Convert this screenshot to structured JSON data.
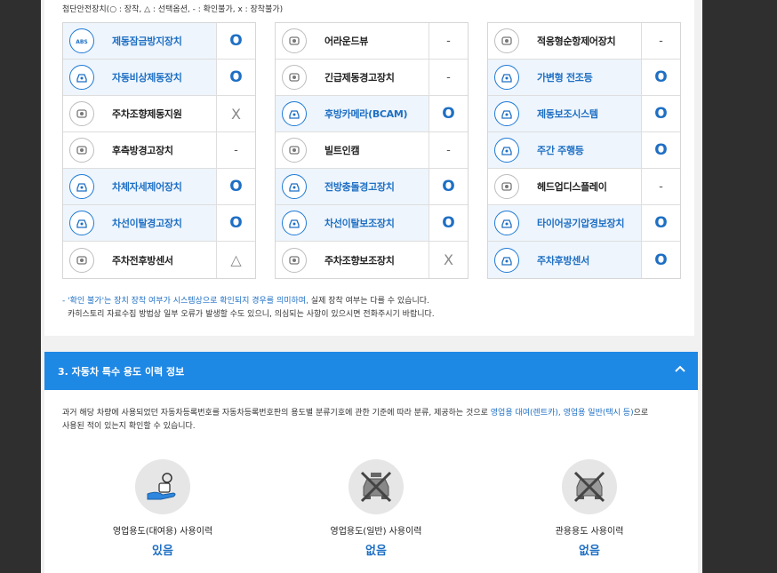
{
  "legend": "첨단안전장치(○ : 장착, △ : 선택옵션, - : 확인불가, x : 장착불가)",
  "tables": [
    [
      {
        "icon": "abs-icon",
        "label": "제동잠금방지장치",
        "status": "O",
        "equipped": true
      },
      {
        "icon": "emergency-brake-icon",
        "label": "자동비상제동장치",
        "status": "O",
        "equipped": true
      },
      {
        "icon": "parking-brake-icon",
        "label": "주차조향제동지원",
        "status": "X",
        "equipped": false
      },
      {
        "icon": "rear-side-warning-icon",
        "label": "후측방경고장치",
        "status": "-",
        "equipped": false
      },
      {
        "icon": "stability-control-icon",
        "label": "차체자세제어장치",
        "status": "O",
        "equipped": true
      },
      {
        "icon": "lane-departure-warning-icon",
        "label": "차선이탈경고장치",
        "status": "O",
        "equipped": true
      },
      {
        "icon": "parking-sensor-icon",
        "label": "주차전후방센서",
        "status": "△",
        "equipped": false
      }
    ],
    [
      {
        "icon": "around-view-icon",
        "label": "어라운드뷰",
        "status": "-",
        "equipped": false
      },
      {
        "icon": "emergency-brake-warning-icon",
        "label": "긴급제동경고장치",
        "status": "-",
        "equipped": false
      },
      {
        "icon": "rear-camera-icon",
        "label": "후방카메라(BCAM)",
        "status": "O",
        "equipped": true
      },
      {
        "icon": "builtin-cam-icon",
        "label": "빌트인캠",
        "status": "-",
        "equipped": false
      },
      {
        "icon": "forward-collision-icon",
        "label": "전방충돌경고장치",
        "status": "O",
        "equipped": true
      },
      {
        "icon": "lane-keeping-icon",
        "label": "차선이탈보조장치",
        "status": "O",
        "equipped": true
      },
      {
        "icon": "parking-assist-icon",
        "label": "주차조향보조장치",
        "status": "X",
        "equipped": false
      }
    ],
    [
      {
        "icon": "adaptive-cruise-icon",
        "label": "적응형순항제어장치",
        "status": "-",
        "equipped": false
      },
      {
        "icon": "adaptive-headlight-icon",
        "label": "가변형 전조등",
        "status": "O",
        "equipped": true
      },
      {
        "icon": "brake-assist-icon",
        "label": "제동보조시스템",
        "status": "O",
        "equipped": true
      },
      {
        "icon": "daytime-running-light-icon",
        "label": "주간 주행등",
        "status": "O",
        "equipped": true
      },
      {
        "icon": "head-up-display-icon",
        "label": "헤드업디스플레이",
        "status": "-",
        "equipped": false
      },
      {
        "icon": "tire-pressure-icon",
        "label": "타이어공기압경보장치",
        "status": "O",
        "equipped": true
      },
      {
        "icon": "rear-parking-sensor-icon",
        "label": "주차후방센서",
        "status": "O",
        "equipped": true
      }
    ]
  ],
  "note1_hl": "- '확인 불가'는 장치 장착 여부가 시스템상으로 확인되지 경우를 의미하며,",
  "note1_rest": " 실제 장착 여부는 다를 수 있습니다.",
  "note2": "카히스토리 자료수집 방법상 일부 오류가 발생할 수도 있으니, 의심되는 사항이 있으시면 전화주시기 바랍니다.",
  "section3": {
    "title": "3. 자동차 특수 용도 이력 정보",
    "desc_a": "과거 해당 차량에 사용되었던 자동차등록번호를 자동차등록번호판의 용도별 분류기호에 관한 기준에 따라 분류, 제공하는 것으로 ",
    "desc_hl": "영업용 대여(렌트카), 영업용 일반(택시 등)",
    "desc_b": "으로",
    "desc_c": "사용된 적이 있는지 확인할 수 있습니다.",
    "items": [
      {
        "icon": "rental-key-icon",
        "label": "영업용도(대여용) 사용이력",
        "value": "있음"
      },
      {
        "icon": "taxi-crossed-icon",
        "label": "영업용도(일반) 사용이력",
        "value": "없음"
      },
      {
        "icon": "government-car-crossed-icon",
        "label": "관용용도 사용이력",
        "value": "없음"
      }
    ]
  },
  "colors": {
    "accent": "#1e88e5",
    "equipped_text": "#1e6fc4",
    "background": "#2f2f2f"
  }
}
